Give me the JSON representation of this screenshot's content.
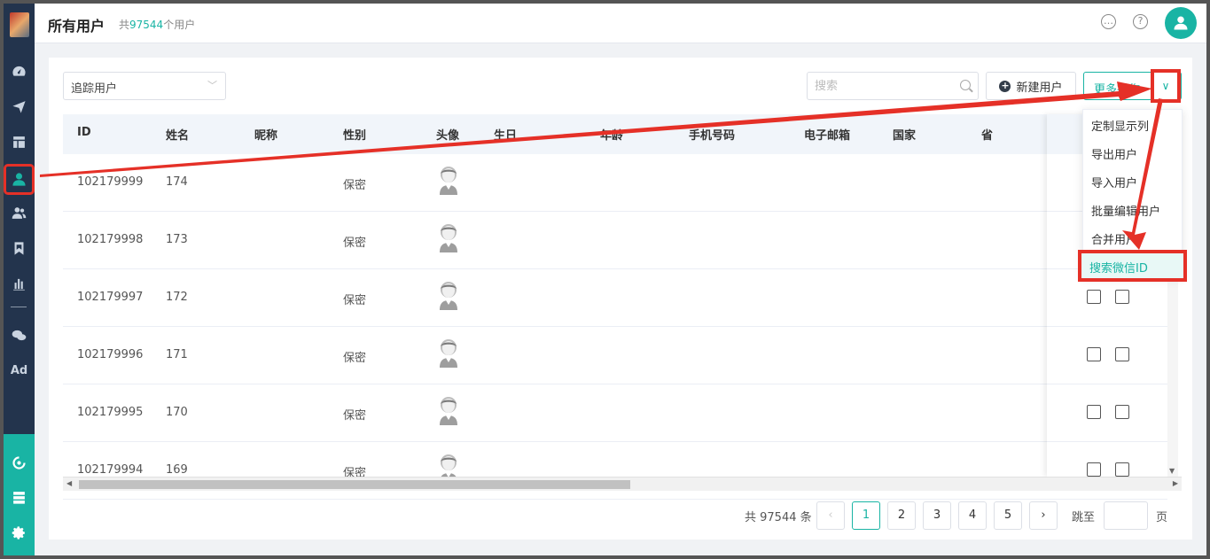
{
  "header": {
    "title": "所有用户",
    "count_prefix": "共",
    "count": "97544",
    "count_suffix": "个用户",
    "chat_icon": "chat-bubble-icon",
    "help_icon": "question-icon",
    "help_glyph": "?",
    "avatar_icon": "user-icon"
  },
  "sidebar": {
    "items": [
      "dashboard-icon",
      "send-icon",
      "layout-icon",
      "user-icon",
      "users-icon",
      "bookmark-icon",
      "bar-chart-icon",
      "wechat-icon",
      "ad-icon"
    ],
    "ad_label": "Ad",
    "bottom_items": [
      "radar-icon",
      "server-icon",
      "gear-icon"
    ]
  },
  "toolbar": {
    "filter_value": "追踪用户",
    "search_placeholder": "搜索",
    "new_user_label": "新建用户",
    "more_label": "更多操作"
  },
  "table": {
    "columns": [
      "ID",
      "姓名",
      "昵称",
      "性别",
      "头像",
      "生日",
      "年龄",
      "手机号码",
      "电子邮箱",
      "国家",
      "省"
    ],
    "rows": [
      {
        "id": "102179999",
        "name": "174",
        "nickname": "",
        "gender": "保密"
      },
      {
        "id": "102179998",
        "name": "173",
        "nickname": "",
        "gender": "保密"
      },
      {
        "id": "102179997",
        "name": "172",
        "nickname": "",
        "gender": "保密"
      },
      {
        "id": "102179996",
        "name": "171",
        "nickname": "",
        "gender": "保密"
      },
      {
        "id": "102179995",
        "name": "170",
        "nickname": "",
        "gender": "保密"
      },
      {
        "id": "102179994",
        "name": "169",
        "nickname": "",
        "gender": "保密"
      }
    ]
  },
  "dropdown": {
    "items": [
      "定制显示列",
      "导出用户",
      "导入用户",
      "批量编辑用户",
      "合并用户",
      "搜索微信ID"
    ],
    "highlighted_index": 5
  },
  "pagination": {
    "total_text": "共 97544 条",
    "pages": [
      "1",
      "2",
      "3",
      "4",
      "5"
    ],
    "current": "1",
    "prev": "‹",
    "next": "›",
    "jump_label": "跳至",
    "page_suffix": "页"
  },
  "colors": {
    "accent": "#19b4a4",
    "sidebar": "#23344d",
    "annotation": "#e53027"
  }
}
